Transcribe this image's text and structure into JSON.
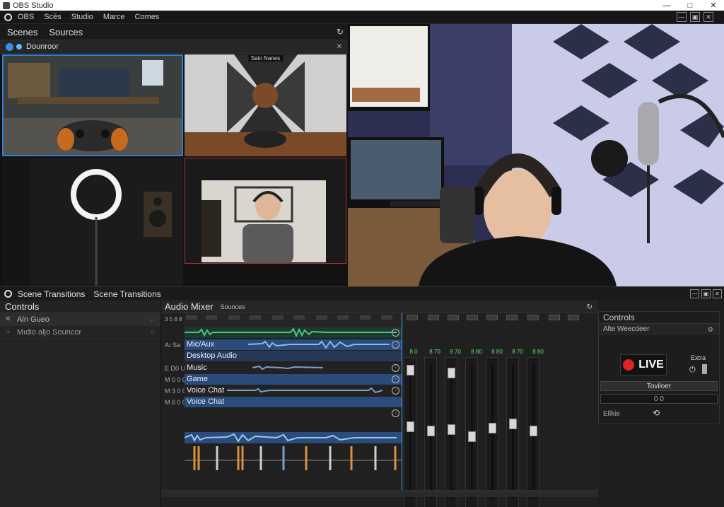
{
  "window": {
    "title": "OBS Studio",
    "controls": [
      "—",
      "□",
      "✕"
    ]
  },
  "menu": {
    "items": [
      "OBS",
      "Scēs",
      "Studio",
      "Marce",
      "Comes"
    ],
    "right_controls": [
      "—",
      "▣",
      "✕"
    ]
  },
  "scenes_panel": {
    "tabs": [
      "Scenes",
      "Sources"
    ],
    "sub_label": "Dounroor",
    "thumb_label": "Saio Nanes"
  },
  "dock": {
    "titles": [
      "Scene Transitions",
      "Scene Transitions"
    ],
    "right_controls": [
      "—",
      "▣",
      "✕"
    ]
  },
  "controls_left": {
    "title": "Controls",
    "rows": [
      {
        "label": "Aln Gueo",
        "icon": "✕"
      },
      {
        "label": "Mıdio aljo Souncor",
        "icon": "⁘"
      }
    ]
  },
  "mixer": {
    "title": "Audio Mixer",
    "subtitle": "Sounces",
    "ruler_label": "3 5 8 8",
    "tracks": [
      {
        "num": "",
        "label": ""
      },
      {
        "num": "Aı Sa",
        "label": "Mic/Aux"
      },
      {
        "num": "",
        "label": "Desktop Audio"
      },
      {
        "num": "E D0 U",
        "label": "Music"
      },
      {
        "num": "M 0 0 0",
        "label": "Game"
      },
      {
        "num": "M 3 0 0",
        "label": "Voice Chat"
      },
      {
        "num": "M 6 0 0",
        "label": "Voice Chat"
      }
    ],
    "channel_values": [
      "8 0",
      "8 70",
      "8 70",
      "8 80",
      "8 80",
      "8 70",
      "8 80"
    ]
  },
  "controls_right": {
    "title": "Controls",
    "sub": "Alte Weecdeer",
    "live_label": "LIVE",
    "side_label": "Extra",
    "toggle_label": "Toviloer",
    "field_value": "0 0",
    "last_label": "Ellkie"
  },
  "colors": {
    "accent": "#2f7fd6",
    "live": "#e02323",
    "meter_green": "#5ee06a"
  }
}
